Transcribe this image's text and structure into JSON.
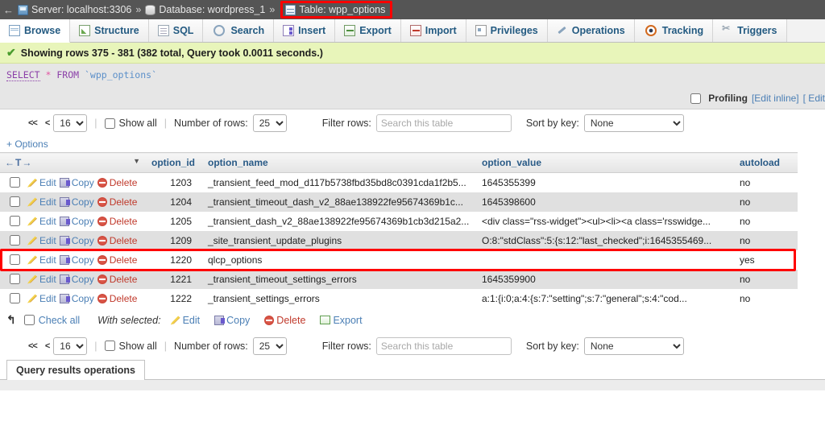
{
  "breadcrumb": {
    "collapse_icon": "left-arrow-icon",
    "server": "Server: localhost:3306",
    "sep1": "»",
    "database": "Database: wordpress_1",
    "sep2": "»",
    "table": "Table: wpp_options",
    "highlight_color": "#ff0000"
  },
  "tabs": [
    {
      "label": "Browse",
      "icon": "browse-icon",
      "active": true
    },
    {
      "label": "Structure",
      "icon": "structure-icon",
      "active": false
    },
    {
      "label": "SQL",
      "icon": "sql-icon",
      "active": false
    },
    {
      "label": "Search",
      "icon": "search-icon",
      "active": false
    },
    {
      "label": "Insert",
      "icon": "insert-icon",
      "active": false
    },
    {
      "label": "Export",
      "icon": "export-icon",
      "active": false
    },
    {
      "label": "Import",
      "icon": "import-icon",
      "active": false
    },
    {
      "label": "Privileges",
      "icon": "privileges-icon",
      "active": false
    },
    {
      "label": "Operations",
      "icon": "operations-icon",
      "active": false
    },
    {
      "label": "Tracking",
      "icon": "tracking-icon",
      "active": false
    },
    {
      "label": "Triggers",
      "icon": "triggers-icon",
      "active": false
    }
  ],
  "status": {
    "icon": "success-check-icon",
    "text": "Showing rows 375 - 381 (382 total, Query took 0.0011 seconds.)",
    "background": "#e8f5ba"
  },
  "sql": {
    "keyword_select": "SELECT",
    "star": "*",
    "keyword_from": "FROM",
    "table": "`wpp_options`"
  },
  "profiling": {
    "label": "Profiling",
    "edit_inline": "[Edit inline]",
    "edit_truncated": "[ Edit",
    "checked": false
  },
  "nav": {
    "first_label": "<<",
    "prev_label": "<",
    "page_value": "16",
    "page_options": [
      "16"
    ],
    "show_all_label": "Show all",
    "show_all_checked": false,
    "rows_label": "Number of rows:",
    "rows_value": "25",
    "rows_options": [
      "25"
    ],
    "filter_label": "Filter rows:",
    "filter_value": "",
    "filter_placeholder": "Search this table",
    "sort_label": "Sort by key:",
    "sort_value": "None",
    "sort_options": [
      "None"
    ]
  },
  "options_link": "+ Options",
  "table": {
    "headers": {
      "actions": "←T→",
      "option_id": "option_id",
      "option_name": "option_name",
      "option_value": "option_value",
      "autoload": "autoload"
    },
    "row_actions": {
      "edit": "Edit",
      "copy": "Copy",
      "delete": "Delete"
    },
    "rows": [
      {
        "option_id": "1203",
        "option_name": "_transient_feed_mod_d117b5738fbd35bd8c0391cda1f2b5...",
        "option_value": "1645355399",
        "autoload": "no",
        "highlighted": false
      },
      {
        "option_id": "1204",
        "option_name": "_transient_timeout_dash_v2_88ae138922fe95674369b1c...",
        "option_value": "1645398600",
        "autoload": "no",
        "highlighted": false
      },
      {
        "option_id": "1205",
        "option_name": "_transient_dash_v2_88ae138922fe95674369b1cb3d215a2...",
        "option_value": "<div class=\"rss-widget\"><ul><li><a class='rsswidge...",
        "autoload": "no",
        "highlighted": false
      },
      {
        "option_id": "1209",
        "option_name": "_site_transient_update_plugins",
        "option_value": "O:8:\"stdClass\":5:{s:12:\"last_checked\";i:1645355469...",
        "autoload": "no",
        "highlighted": false
      },
      {
        "option_id": "1220",
        "option_name": "qlcp_options",
        "option_value": "",
        "autoload": "yes",
        "highlighted": true
      },
      {
        "option_id": "1221",
        "option_name": "_transient_timeout_settings_errors",
        "option_value": "1645359900",
        "autoload": "no",
        "highlighted": false
      },
      {
        "option_id": "1222",
        "option_name": "_transient_settings_errors",
        "option_value": "a:1:{i:0;a:4:{s:7:\"setting\";s:7:\"general\";s:4:\"cod...",
        "autoload": "no",
        "highlighted": false
      }
    ]
  },
  "footer": {
    "arrow_icon": "arrow-up-left-icon",
    "check_all": "Check all",
    "with_selected": "With selected:",
    "edit": "Edit",
    "copy": "Copy",
    "delete": "Delete",
    "export": "Export"
  },
  "query_results_operations": "Query results operations"
}
